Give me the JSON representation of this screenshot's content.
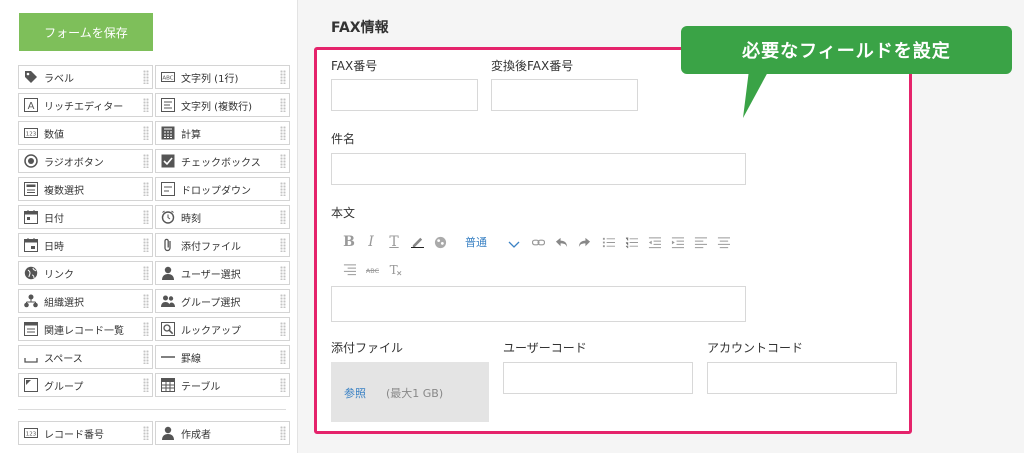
{
  "palette": {
    "save_label": "フォームを保存",
    "items": [
      {
        "label": "ラベル",
        "icon": "tag-icon"
      },
      {
        "label": "文字列 (1行)",
        "icon": "abc-text-icon"
      },
      {
        "label": "リッチエディター",
        "icon": "rich-editor-icon"
      },
      {
        "label": "文字列 (複数行)",
        "icon": "multiline-text-icon"
      },
      {
        "label": "数値",
        "icon": "number-icon"
      },
      {
        "label": "計算",
        "icon": "calculator-icon"
      },
      {
        "label": "ラジオボタン",
        "icon": "radio-icon"
      },
      {
        "label": "チェックボックス",
        "icon": "checkbox-icon"
      },
      {
        "label": "複数選択",
        "icon": "multi-select-icon"
      },
      {
        "label": "ドロップダウン",
        "icon": "dropdown-icon"
      },
      {
        "label": "日付",
        "icon": "calendar-icon"
      },
      {
        "label": "時刻",
        "icon": "clock-icon"
      },
      {
        "label": "日時",
        "icon": "calendar-time-icon"
      },
      {
        "label": "添付ファイル",
        "icon": "paperclip-icon"
      },
      {
        "label": "リンク",
        "icon": "globe-icon"
      },
      {
        "label": "ユーザー選択",
        "icon": "user-icon"
      },
      {
        "label": "組織選択",
        "icon": "org-icon"
      },
      {
        "label": "グループ選択",
        "icon": "group-icon"
      },
      {
        "label": "関連レコード一覧",
        "icon": "related-records-icon"
      },
      {
        "label": "ルックアップ",
        "icon": "lookup-icon"
      },
      {
        "label": "スペース",
        "icon": "space-icon"
      },
      {
        "label": "罫線",
        "icon": "line-icon"
      },
      {
        "label": "グループ",
        "icon": "field-group-icon"
      },
      {
        "label": "テーブル",
        "icon": "table-icon"
      },
      {
        "label": "レコード番号",
        "icon": "record-number-icon"
      },
      {
        "label": "作成者",
        "icon": "creator-icon"
      }
    ]
  },
  "form": {
    "group_title": "FAX情報",
    "fields": {
      "fax_number": "FAX番号",
      "converted_fax_number": "変換後FAX番号",
      "subject": "件名",
      "body": "本文",
      "attachment": "添付ファイル",
      "user_code": "ユーザーコード",
      "account_code": "アカウントコード"
    },
    "editor": {
      "font_select": "普通"
    },
    "attachment": {
      "browse_label": "参照",
      "max_size": "(最大1 GB)"
    }
  },
  "callout": {
    "text": "必要なフィールドを設定"
  },
  "colors": {
    "accent_green": "#7ebf5a",
    "callout_green": "#3aa346",
    "highlight_pink": "#e5236b",
    "link_blue": "#3b82c4"
  }
}
